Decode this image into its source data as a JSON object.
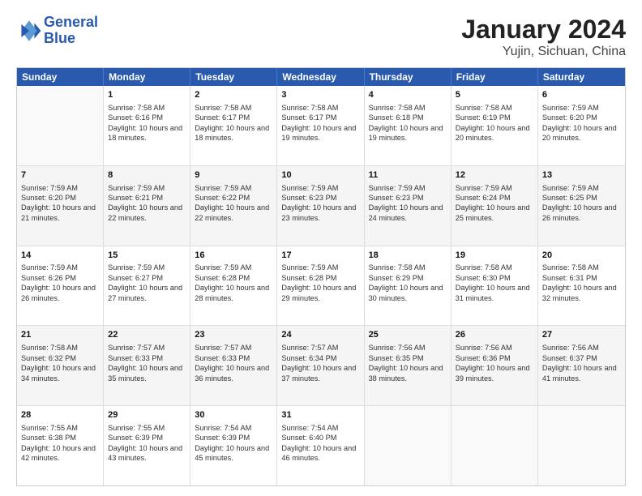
{
  "logo": {
    "line1": "General",
    "line2": "Blue"
  },
  "title": "January 2024",
  "subtitle": "Yujin, Sichuan, China",
  "header_days": [
    "Sunday",
    "Monday",
    "Tuesday",
    "Wednesday",
    "Thursday",
    "Friday",
    "Saturday"
  ],
  "weeks": [
    [
      {
        "day": "",
        "sunrise": "",
        "sunset": "",
        "daylight": ""
      },
      {
        "day": "1",
        "sunrise": "Sunrise: 7:58 AM",
        "sunset": "Sunset: 6:16 PM",
        "daylight": "Daylight: 10 hours and 18 minutes."
      },
      {
        "day": "2",
        "sunrise": "Sunrise: 7:58 AM",
        "sunset": "Sunset: 6:17 PM",
        "daylight": "Daylight: 10 hours and 18 minutes."
      },
      {
        "day": "3",
        "sunrise": "Sunrise: 7:58 AM",
        "sunset": "Sunset: 6:17 PM",
        "daylight": "Daylight: 10 hours and 19 minutes."
      },
      {
        "day": "4",
        "sunrise": "Sunrise: 7:58 AM",
        "sunset": "Sunset: 6:18 PM",
        "daylight": "Daylight: 10 hours and 19 minutes."
      },
      {
        "day": "5",
        "sunrise": "Sunrise: 7:58 AM",
        "sunset": "Sunset: 6:19 PM",
        "daylight": "Daylight: 10 hours and 20 minutes."
      },
      {
        "day": "6",
        "sunrise": "Sunrise: 7:59 AM",
        "sunset": "Sunset: 6:20 PM",
        "daylight": "Daylight: 10 hours and 20 minutes."
      }
    ],
    [
      {
        "day": "7",
        "sunrise": "Sunrise: 7:59 AM",
        "sunset": "Sunset: 6:20 PM",
        "daylight": "Daylight: 10 hours and 21 minutes."
      },
      {
        "day": "8",
        "sunrise": "Sunrise: 7:59 AM",
        "sunset": "Sunset: 6:21 PM",
        "daylight": "Daylight: 10 hours and 22 minutes."
      },
      {
        "day": "9",
        "sunrise": "Sunrise: 7:59 AM",
        "sunset": "Sunset: 6:22 PM",
        "daylight": "Daylight: 10 hours and 22 minutes."
      },
      {
        "day": "10",
        "sunrise": "Sunrise: 7:59 AM",
        "sunset": "Sunset: 6:23 PM",
        "daylight": "Daylight: 10 hours and 23 minutes."
      },
      {
        "day": "11",
        "sunrise": "Sunrise: 7:59 AM",
        "sunset": "Sunset: 6:23 PM",
        "daylight": "Daylight: 10 hours and 24 minutes."
      },
      {
        "day": "12",
        "sunrise": "Sunrise: 7:59 AM",
        "sunset": "Sunset: 6:24 PM",
        "daylight": "Daylight: 10 hours and 25 minutes."
      },
      {
        "day": "13",
        "sunrise": "Sunrise: 7:59 AM",
        "sunset": "Sunset: 6:25 PM",
        "daylight": "Daylight: 10 hours and 26 minutes."
      }
    ],
    [
      {
        "day": "14",
        "sunrise": "Sunrise: 7:59 AM",
        "sunset": "Sunset: 6:26 PM",
        "daylight": "Daylight: 10 hours and 26 minutes."
      },
      {
        "day": "15",
        "sunrise": "Sunrise: 7:59 AM",
        "sunset": "Sunset: 6:27 PM",
        "daylight": "Daylight: 10 hours and 27 minutes."
      },
      {
        "day": "16",
        "sunrise": "Sunrise: 7:59 AM",
        "sunset": "Sunset: 6:28 PM",
        "daylight": "Daylight: 10 hours and 28 minutes."
      },
      {
        "day": "17",
        "sunrise": "Sunrise: 7:59 AM",
        "sunset": "Sunset: 6:28 PM",
        "daylight": "Daylight: 10 hours and 29 minutes."
      },
      {
        "day": "18",
        "sunrise": "Sunrise: 7:58 AM",
        "sunset": "Sunset: 6:29 PM",
        "daylight": "Daylight: 10 hours and 30 minutes."
      },
      {
        "day": "19",
        "sunrise": "Sunrise: 7:58 AM",
        "sunset": "Sunset: 6:30 PM",
        "daylight": "Daylight: 10 hours and 31 minutes."
      },
      {
        "day": "20",
        "sunrise": "Sunrise: 7:58 AM",
        "sunset": "Sunset: 6:31 PM",
        "daylight": "Daylight: 10 hours and 32 minutes."
      }
    ],
    [
      {
        "day": "21",
        "sunrise": "Sunrise: 7:58 AM",
        "sunset": "Sunset: 6:32 PM",
        "daylight": "Daylight: 10 hours and 34 minutes."
      },
      {
        "day": "22",
        "sunrise": "Sunrise: 7:57 AM",
        "sunset": "Sunset: 6:33 PM",
        "daylight": "Daylight: 10 hours and 35 minutes."
      },
      {
        "day": "23",
        "sunrise": "Sunrise: 7:57 AM",
        "sunset": "Sunset: 6:33 PM",
        "daylight": "Daylight: 10 hours and 36 minutes."
      },
      {
        "day": "24",
        "sunrise": "Sunrise: 7:57 AM",
        "sunset": "Sunset: 6:34 PM",
        "daylight": "Daylight: 10 hours and 37 minutes."
      },
      {
        "day": "25",
        "sunrise": "Sunrise: 7:56 AM",
        "sunset": "Sunset: 6:35 PM",
        "daylight": "Daylight: 10 hours and 38 minutes."
      },
      {
        "day": "26",
        "sunrise": "Sunrise: 7:56 AM",
        "sunset": "Sunset: 6:36 PM",
        "daylight": "Daylight: 10 hours and 39 minutes."
      },
      {
        "day": "27",
        "sunrise": "Sunrise: 7:56 AM",
        "sunset": "Sunset: 6:37 PM",
        "daylight": "Daylight: 10 hours and 41 minutes."
      }
    ],
    [
      {
        "day": "28",
        "sunrise": "Sunrise: 7:55 AM",
        "sunset": "Sunset: 6:38 PM",
        "daylight": "Daylight: 10 hours and 42 minutes."
      },
      {
        "day": "29",
        "sunrise": "Sunrise: 7:55 AM",
        "sunset": "Sunset: 6:39 PM",
        "daylight": "Daylight: 10 hours and 43 minutes."
      },
      {
        "day": "30",
        "sunrise": "Sunrise: 7:54 AM",
        "sunset": "Sunset: 6:39 PM",
        "daylight": "Daylight: 10 hours and 45 minutes."
      },
      {
        "day": "31",
        "sunrise": "Sunrise: 7:54 AM",
        "sunset": "Sunset: 6:40 PM",
        "daylight": "Daylight: 10 hours and 46 minutes."
      },
      {
        "day": "",
        "sunrise": "",
        "sunset": "",
        "daylight": ""
      },
      {
        "day": "",
        "sunrise": "",
        "sunset": "",
        "daylight": ""
      },
      {
        "day": "",
        "sunrise": "",
        "sunset": "",
        "daylight": ""
      }
    ]
  ]
}
